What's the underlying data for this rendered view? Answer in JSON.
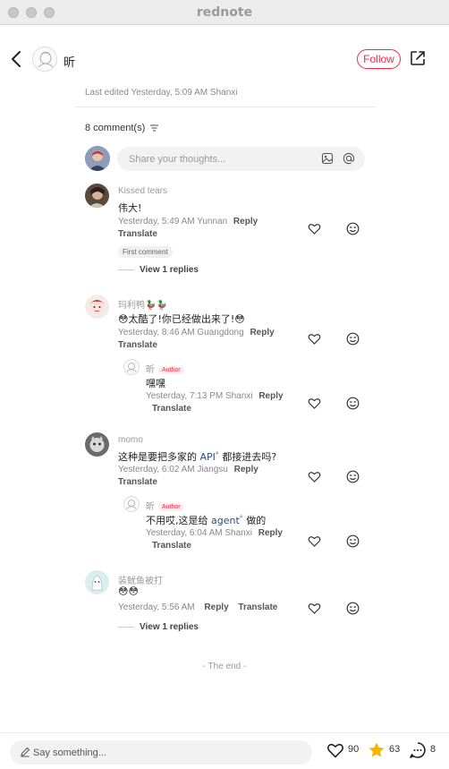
{
  "app_title": "rednote",
  "header": {
    "author": "昕",
    "follow_label": "Follow"
  },
  "post": {
    "edited": "Last edited Yesterday, 5:09 AM Shanxi"
  },
  "comments_section": {
    "count_label": "8 comment(s)",
    "share_placeholder": "Share your thoughts..."
  },
  "comments": [
    {
      "username": "Kissed tears",
      "text": "伟大!",
      "meta": "Yesterday, 5:49 AM Yunnan",
      "reply_label": "Reply",
      "translate_label": "Translate",
      "badge": "First comment",
      "view_replies": "View 1 replies"
    },
    {
      "username": "玛利鸭🦆🦆",
      "text": "😳太酷了!你已经做出来了!😳",
      "meta": "Yesterday, 8:46 AM Guangdong",
      "reply_label": "Reply",
      "translate_label": "Translate",
      "reply": {
        "username": "昕",
        "badge": "Author",
        "text": "嘿嘿",
        "meta": "Yesterday, 7:13 PM Shanxi",
        "reply_label": "Reply",
        "translate_label": "Translate"
      }
    },
    {
      "username": "momo",
      "text_before": "这种是要把多家的 ",
      "text_link": "API",
      "text_after": " 都接进去吗?",
      "meta": "Yesterday, 6:02 AM Jiangsu",
      "reply_label": "Reply",
      "translate_label": "Translate",
      "reply": {
        "username": "昕",
        "badge": "Author",
        "text_before": "不用哎,这是给 ",
        "text_link": "agent",
        "text_after": " 做的",
        "meta": "Yesterday, 6:04 AM Shanxi",
        "reply_label": "Reply",
        "translate_label": "Translate"
      }
    },
    {
      "username": "装鱿鱼被打",
      "text": "😳😳",
      "meta": "Yesterday, 5:56 AM",
      "reply_label": "Reply",
      "translate_label": "Translate",
      "view_replies": "View 1 replies"
    }
  ],
  "the_end": "- The end -",
  "bottom_bar": {
    "say_placeholder": "Say something...",
    "likes": "90",
    "stars": "63",
    "comments": "8"
  },
  "colors": {
    "brand_red": "#ff2442",
    "star_yellow": "#f7b500",
    "link_blue": "#2c4a8a"
  },
  "icons": [
    "back-icon",
    "share-icon",
    "sort-icon",
    "image-icon",
    "at-icon",
    "heart-icon",
    "emoji-icon",
    "pen-icon",
    "star-icon",
    "comment-icon"
  ]
}
